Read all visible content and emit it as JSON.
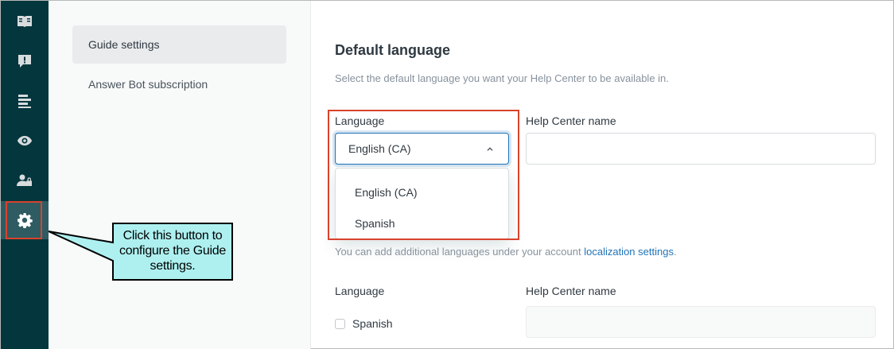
{
  "rail": {
    "items": [
      {
        "name": "guide-articles-icon",
        "active": false
      },
      {
        "name": "content-alert-icon",
        "active": false
      },
      {
        "name": "arrange-content-icon",
        "active": false
      },
      {
        "name": "preview-eye-icon",
        "active": false
      },
      {
        "name": "user-permissions-icon",
        "active": false
      },
      {
        "name": "settings-gear-icon",
        "active": true
      }
    ]
  },
  "subnav": {
    "items": [
      "Guide settings",
      "Answer Bot subscription"
    ]
  },
  "main": {
    "heading": "Default language",
    "description": "Select the default language you want your Help Center to be available in.",
    "default_language": {
      "language_label": "Language",
      "selected_value": "English (CA)",
      "name_label": "Help Center name",
      "name_value": ""
    },
    "dropdown_options": [
      "English (CA)",
      "Spanish"
    ],
    "hint_prefix": "You can add additional languages under your account ",
    "hint_link": "localization settings",
    "hint_suffix": ".",
    "additional": {
      "language_label": "Language",
      "name_label": "Help Center name",
      "checkbox_label": "Spanish",
      "checked": false
    }
  },
  "annotation": {
    "text": "Click this button to configure the Guide settings.",
    "fill": "#aef0f0",
    "highlight_color": "#d9432c"
  }
}
